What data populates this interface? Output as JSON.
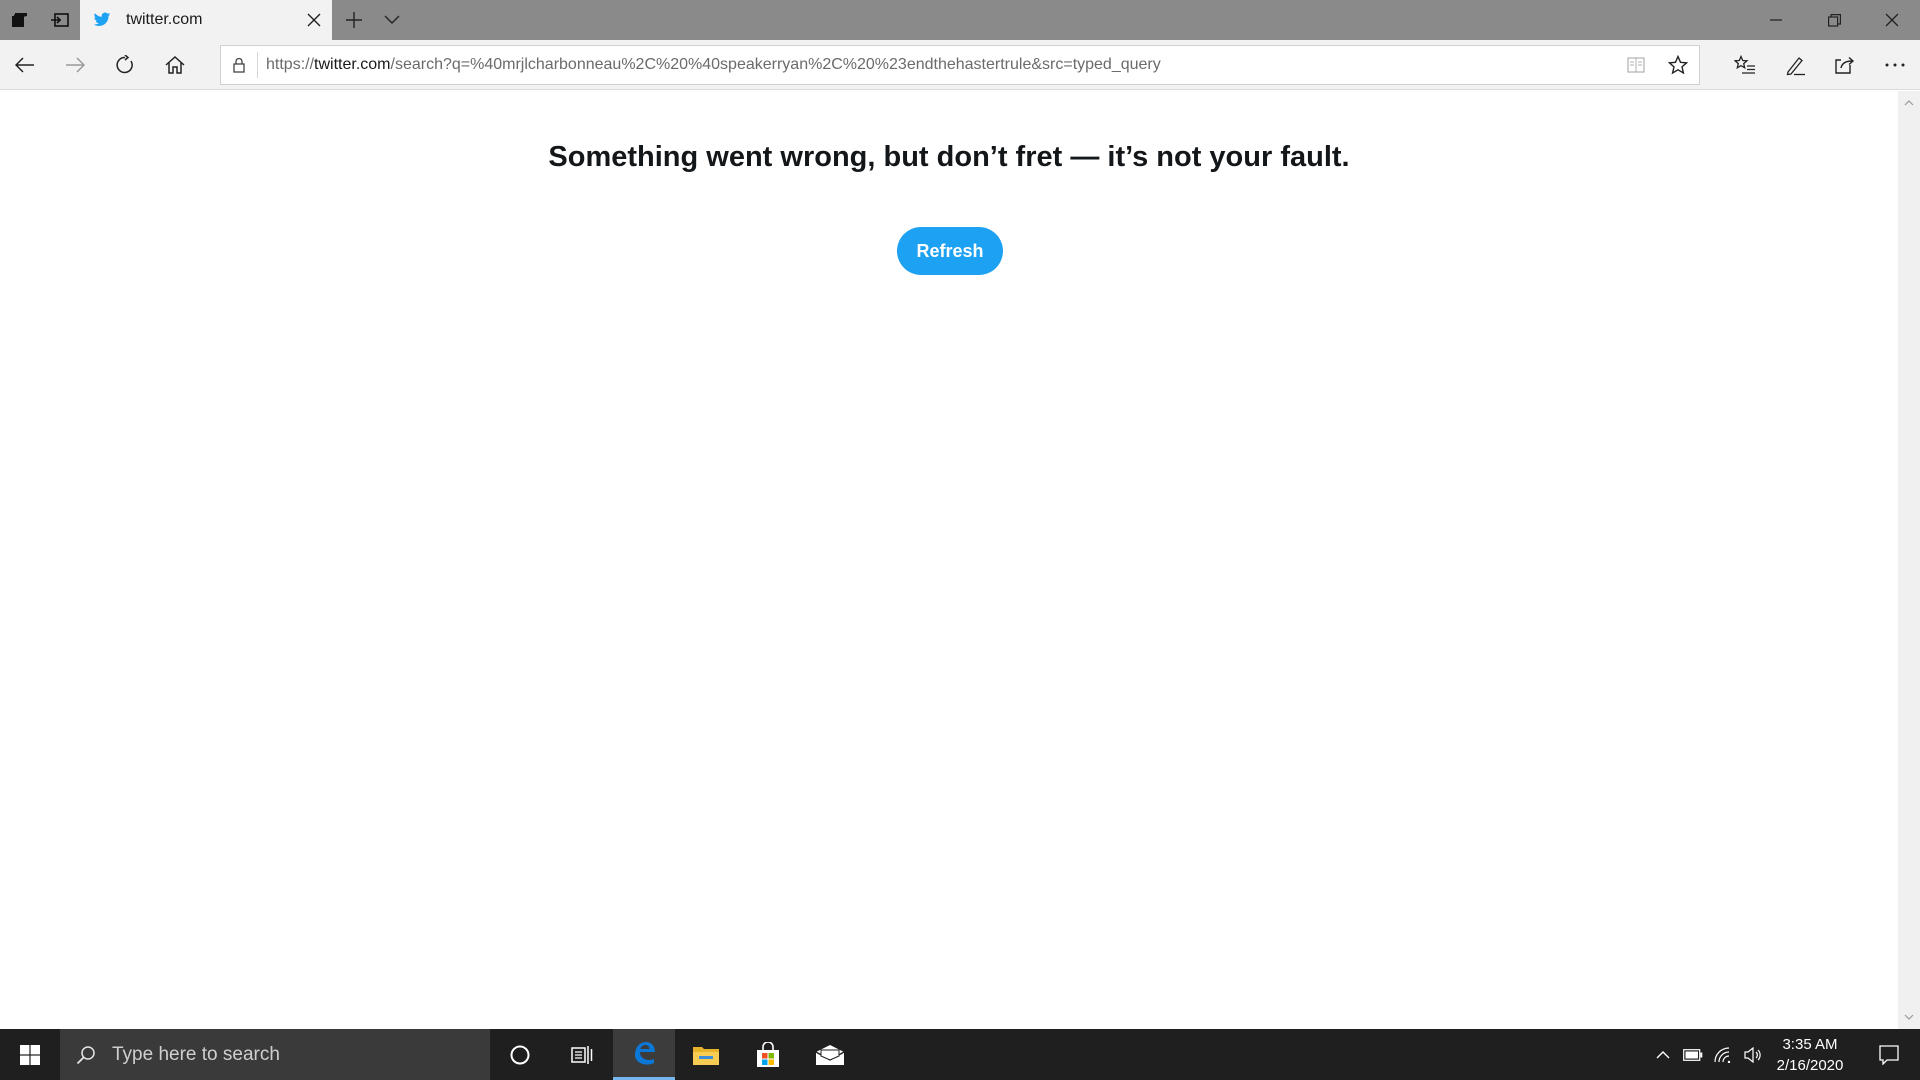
{
  "browser": {
    "tab": {
      "title": "twitter.com",
      "favicon": "twitter-bird-icon"
    },
    "url": {
      "prefix": "https://",
      "domain": "twitter.com",
      "path": "/search?q=%40mrjlcharbonneau%2C%20%40speakerryan%2C%20%23endthehastertrule&src=typed_query"
    },
    "icons": {
      "set_aside": "tabs-aside-icon",
      "back_tabs": "restore-tabs-icon",
      "new_tab": "plus-icon",
      "tab_list": "chevron-down-icon",
      "minimize": "minimize-icon",
      "maximize": "restore-window-icon",
      "close": "close-icon",
      "back": "back-arrow-icon",
      "forward": "forward-arrow-icon",
      "refresh": "refresh-icon",
      "home": "home-icon",
      "lock": "lock-icon",
      "reading_view": "reading-view-icon",
      "favorite": "star-icon",
      "favorites": "favorites-list-icon",
      "pen": "pen-icon",
      "share": "share-icon",
      "more": "more-icon"
    }
  },
  "page": {
    "error_message": "Something went wrong, but don’t fret — it’s not your fault.",
    "refresh_label": "Refresh",
    "accent": "#1da1f2"
  },
  "taskbar": {
    "search_placeholder": "Type here to search",
    "time": "3:35 AM",
    "date": "2/16/2020",
    "apps": [
      "cortana-icon",
      "task-view-icon",
      "edge-icon",
      "file-explorer-icon",
      "store-icon",
      "mail-icon"
    ]
  }
}
